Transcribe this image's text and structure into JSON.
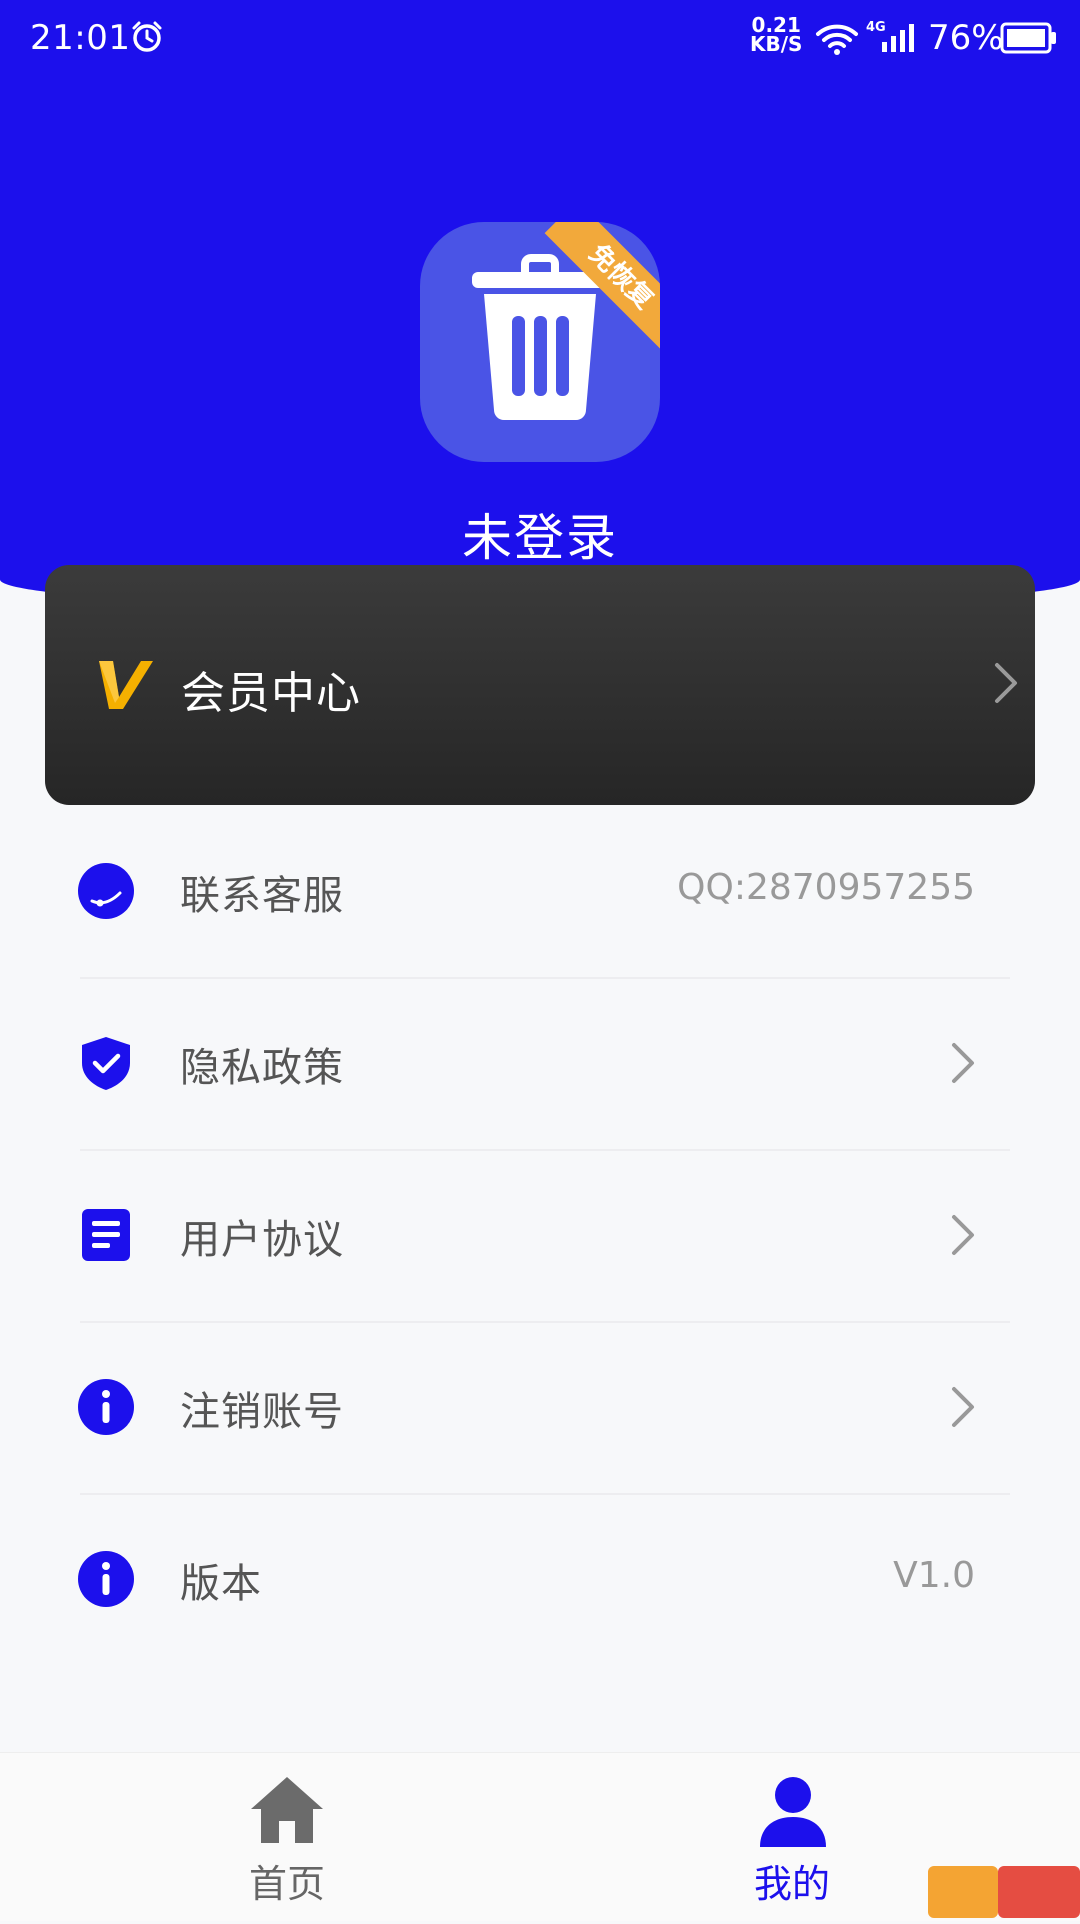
{
  "status_bar": {
    "time": "21:01",
    "speed_value": "0.21",
    "speed_unit": "KB/S",
    "network": "4G",
    "battery": "76%"
  },
  "header": {
    "badge": "免恢复",
    "login_status": "未登录"
  },
  "vip": {
    "label": "会员中心"
  },
  "menu": [
    {
      "label": "联系客服",
      "value": "QQ:2870957255"
    },
    {
      "label": "隐私政策"
    },
    {
      "label": "用户协议"
    },
    {
      "label": "注销账号"
    },
    {
      "label": "版本",
      "value": "V1.0"
    }
  ],
  "tabbar": {
    "home": "首页",
    "me": "我的"
  },
  "colors": {
    "primary": "#1c10ec",
    "app_icon": "#4a54e6",
    "badge": "#f2a93b",
    "vip_accent": "#f5b000"
  },
  "icons": [
    "alarm-icon",
    "wifi-icon",
    "signal-icon",
    "battery-icon",
    "trash-icon",
    "vip-v-icon",
    "headset-icon",
    "shield-check-icon",
    "document-icon",
    "info-icon",
    "chevron-right-icon",
    "home-icon",
    "user-icon"
  ]
}
